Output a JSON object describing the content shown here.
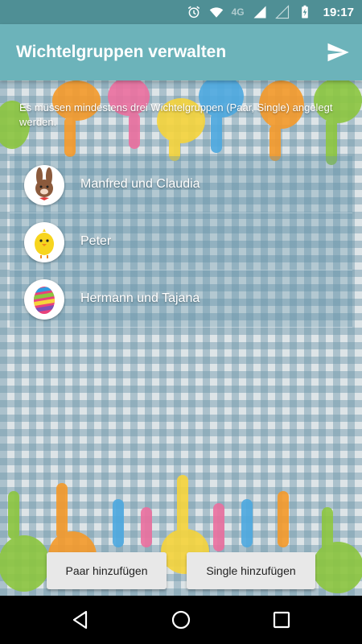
{
  "status_bar": {
    "time": "19:17",
    "network": "4G",
    "icons": [
      "alarm-icon",
      "wifi-icon",
      "signal-icon",
      "battery-charging-icon"
    ]
  },
  "app_bar": {
    "title": "Wichtelgruppen verwalten",
    "action_icon": "send-icon"
  },
  "info_text": "Es müssen mindestens drei Wichtelgruppen (Paar, Single) angelegt werden.",
  "groups": [
    {
      "name": "Manfred und Claudia",
      "avatar": "bunny-avatar-icon"
    },
    {
      "name": "Peter",
      "avatar": "chick-avatar-icon"
    },
    {
      "name": "Hermann und Tajana",
      "avatar": "easter-egg-avatar-icon"
    }
  ],
  "buttons": {
    "add_pair": "Paar hinzufügen",
    "add_single": "Single hinzufügen"
  },
  "nav_bar": {
    "icons": [
      "back-icon",
      "home-icon",
      "recent-apps-icon"
    ]
  },
  "colors": {
    "status_bar": "#4f8f95",
    "app_bar": "#6cb3ba",
    "button_bg": "#e8e8e8"
  }
}
